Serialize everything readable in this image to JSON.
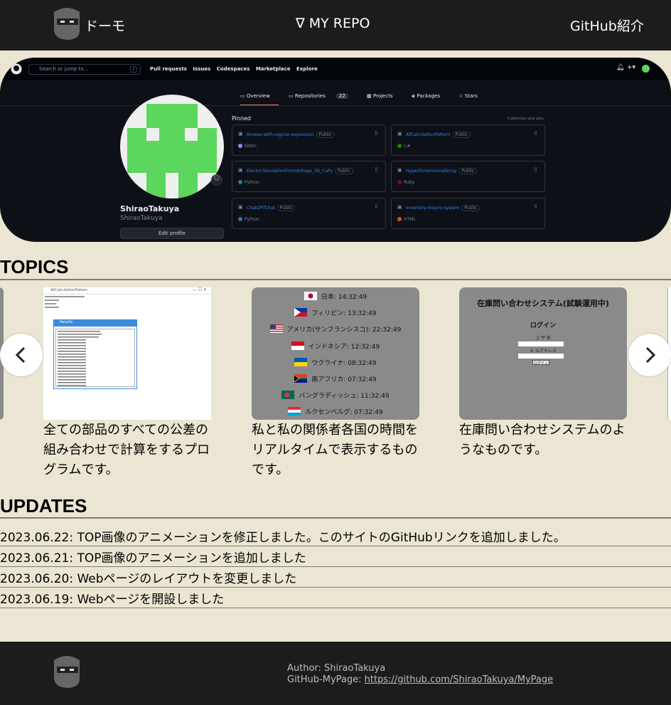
{
  "header": {
    "brand": "ドーモ",
    "nav_center": "∇ MY REPO",
    "nav_right": "GitHub紹介"
  },
  "hero": {
    "search_placeholder": "Search or jump to...",
    "search_key": "/",
    "main_nav": [
      "Pull requests",
      "Issues",
      "Codespaces",
      "Marketplace",
      "Explore"
    ],
    "tabs": {
      "overview": "Overview",
      "repositories": "Repositories",
      "repositories_count": "22",
      "projects": "Projects",
      "packages": "Packages",
      "stars": "Stars"
    },
    "profile_name": "ShiraoTakuya",
    "profile_login": "ShiraoTakuya",
    "edit_profile": "Edit profile",
    "pinned_label": "Pinned",
    "customize_label": "Customize your pins",
    "pinned": [
      {
        "name": "Browse-with-regular-expression",
        "visibility": "Public",
        "language": "Kotlin",
        "color": "#a97bff"
      },
      {
        "name": "AllCalculationPattern",
        "visibility": "Public",
        "language": "C#",
        "color": "#178600"
      },
      {
        "name": "ElectricSimulationFromVoltage_3D_CuPy",
        "visibility": "Public",
        "language": "Python",
        "color": "#3572a5"
      },
      {
        "name": "HyperDimensionalArray",
        "visibility": "Public",
        "language": "Ruby",
        "color": "#701516"
      },
      {
        "name": "ChatGPTChat",
        "visibility": "Public",
        "language": "Python",
        "color": "#3572a5"
      },
      {
        "name": "Inventory-inquiry-system",
        "visibility": "Public",
        "language": "HTML",
        "color": "#e34c26"
      }
    ]
  },
  "topics": {
    "title": "TOPICS",
    "cards": [
      {
        "text": "全ての部品のすべての公差の組み合わせで計算をするプログラムです。"
      },
      {
        "text": "私と私の関係者各国の時間をリアルタイムで表示するものです。"
      },
      {
        "text": "在庫問い合わせシステムのようなものです。"
      }
    ],
    "clock_rows": [
      {
        "label": "日本: 14:32:49"
      },
      {
        "label": "フィリピン: 13:32:49"
      },
      {
        "label": "アメリカ(サンフランシスコ): 22:32:49"
      },
      {
        "label": "インドネシア: 12:32:49"
      },
      {
        "label": "ウクライナ: 08:32:49"
      },
      {
        "label": "南アフリカ: 07:32:49"
      },
      {
        "label": "バングラディッシュ: 11:32:49"
      },
      {
        "label": "ルクセンベルグ: 07:32:49"
      }
    ],
    "inventory": {
      "title": "在庫問い合わせシステム(試験運用中)",
      "login": "ログイン",
      "user": "ユ ザ 名",
      "mail": "メ ルアドレス",
      "button": "ログイン"
    },
    "calc_window": {
      "title": "AllCalculationPattern",
      "results_title": "Results"
    }
  },
  "updates": {
    "title": "UPDATES",
    "items": [
      "2023.06.22: TOP画像のアニメーションを修正しました。このサイトのGitHubリンクを追加しました。",
      "2023.06.21: TOP画像のアニメーションを追加しました",
      "2023.06.20: Webページのレイアウトを変更しました",
      "2023.06.19: Webページを開設しました"
    ]
  },
  "footer": {
    "author": "Author: ShiraoTakuya",
    "github_label": "GitHub-MyPage: ",
    "github_url": "https://github.com/ShiraoTakuya/MyPage"
  },
  "colors": {
    "background": "#ebe6d3",
    "header": "#1c1c1c",
    "avatar_green": "#5cd65c"
  }
}
